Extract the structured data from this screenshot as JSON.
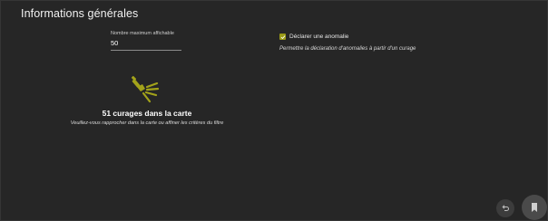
{
  "header": {
    "title": "Informations générales"
  },
  "max_display": {
    "label": "Nombre maximum affichable",
    "value": "50"
  },
  "anomaly": {
    "checkbox_label": "Déclarer une anomalie",
    "checked": true,
    "description": "Permettre la déclaration d'anomalies à partir d'un curage"
  },
  "map_result": {
    "count_text": "51 curages dans la carte",
    "hint_text": "Veuillez-vous rapprocher dans la carte ou affiner les critères du filtre"
  },
  "icons": {
    "center": "spray-nozzle-icon",
    "undo": "undo-icon",
    "bookmark": "bookmark-icon"
  },
  "colors": {
    "accent": "#9a9a17",
    "background": "#262626"
  }
}
